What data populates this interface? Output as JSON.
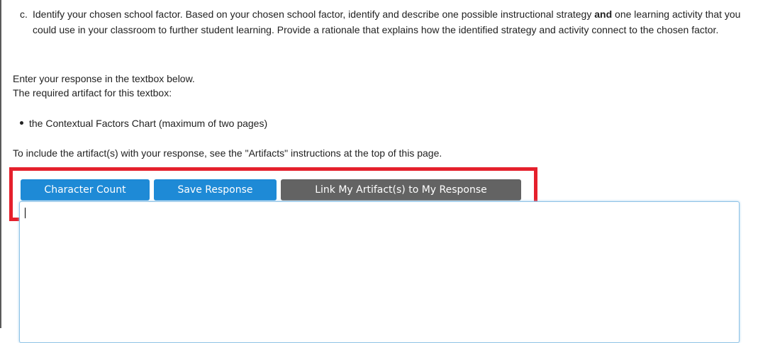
{
  "prompt": {
    "marker": "c.",
    "text_before_bold": "Identify your chosen school factor. Based on your chosen school factor, identify and describe one possible instructional strategy",
    "bold_word": "and",
    "text_after_bold": "one learning activity that you could use in your classroom to further student learning. Provide a rationale that explains how the identified strategy and activity connect to the chosen factor."
  },
  "instructions": {
    "enter_response": "Enter your response in the textbox below.",
    "required_artifact_label": "The required artifact for this textbox:",
    "artifact_item": "the Contextual Factors Chart (maximum of two pages)",
    "include_artifacts": "To include the artifact(s) with your response, see the \"Artifacts\" instructions at the top of this page."
  },
  "toolbar": {
    "character_count_label": "Character Count",
    "save_response_label": "Save Response",
    "link_artifacts_label": "Link My Artifact(s) to My Response"
  },
  "response": {
    "value": ""
  },
  "colors": {
    "primary_button": "#1e8ad6",
    "secondary_button": "#636363",
    "highlight": "#e5202c"
  }
}
